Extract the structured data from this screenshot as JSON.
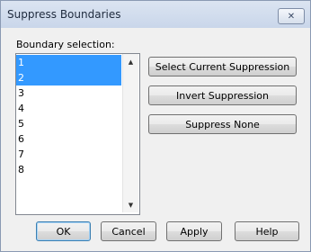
{
  "window": {
    "title": "Suppress Boundaries",
    "close_label": "✕"
  },
  "boundary_selection": {
    "label": "Boundary selection:",
    "items": [
      "1",
      "2",
      "3",
      "4",
      "5",
      "6",
      "7",
      "8"
    ],
    "selected": [
      "1",
      "2"
    ]
  },
  "scrollbar": {
    "up_icon": "▲",
    "down_icon": "▼"
  },
  "actions": {
    "select_current": "Select Current Suppression",
    "invert": "Invert Suppression",
    "suppress_none": "Suppress None"
  },
  "footer": {
    "ok": "OK",
    "cancel": "Cancel",
    "apply": "Apply",
    "help": "Help"
  }
}
